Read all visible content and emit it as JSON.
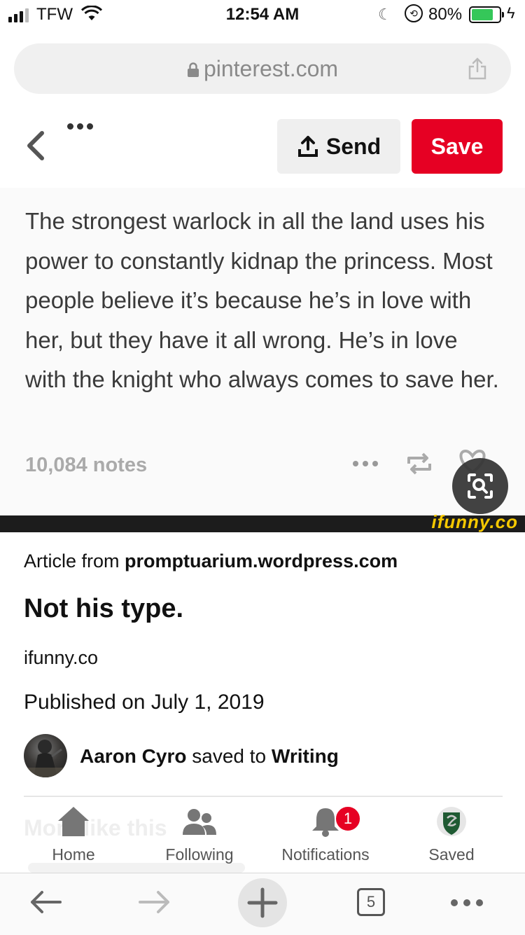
{
  "status_bar": {
    "carrier": "TFW",
    "time": "12:54 AM",
    "battery_percent_label": "80%",
    "battery_level": 0.8
  },
  "browser": {
    "url": "pinterest.com",
    "icons": [
      "lock-icon",
      "share-icon"
    ]
  },
  "pin_header": {
    "send_label": "Send",
    "save_label": "Save",
    "icons": [
      "back-chevron-icon",
      "more-icon",
      "upload-icon"
    ]
  },
  "post": {
    "text": "The strongest warlock in all the land uses his power to constantly kidnap the princess. Most people believe it’s because he’s in love with her, but they have it all wrong. He’s in love with the knight who always comes to save her.",
    "notes": "10,084 notes",
    "watermark": "ifunny.co",
    "icons": [
      "more-icon",
      "reblog-icon",
      "heart-icon",
      "visual-search-icon"
    ]
  },
  "details": {
    "article_from_prefix": "Article from",
    "article_source": "promptuarium.wordpress.com",
    "title": "Not his type.",
    "domain": "ifunny.co",
    "published": "Published on July 1, 2019",
    "saver_name": "Aaron Cyro",
    "saved_to_text": "saved to",
    "board_name": "Writing",
    "more_like_this": "More like this"
  },
  "tab_bar": {
    "tabs": [
      {
        "label": "Home",
        "icon": "home-icon"
      },
      {
        "label": "Following",
        "icon": "people-icon"
      },
      {
        "label": "Notifications",
        "icon": "bell-icon"
      },
      {
        "label": "Saved",
        "icon": "crest-avatar-icon"
      }
    ],
    "notification_count": "1"
  },
  "safari_toolbar": {
    "tab_count": "5",
    "icons": [
      "back-arrow-icon",
      "forward-arrow-icon",
      "plus-icon",
      "tabs-icon",
      "more-icon"
    ]
  },
  "colors": {
    "save_red": "#e60023",
    "ifunny_yellow": "#f5c800",
    "battery_green": "#35c759"
  }
}
